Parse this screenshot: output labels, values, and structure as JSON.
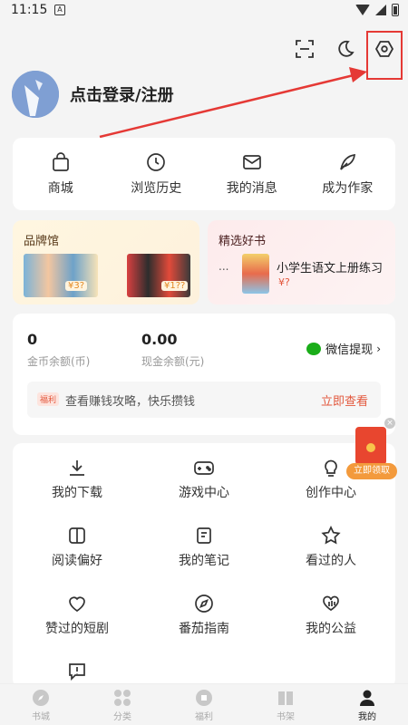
{
  "status": {
    "time": "11:15",
    "notif_icon": "A"
  },
  "header": {
    "login_label": "点击登录/注册"
  },
  "quick_actions": [
    {
      "label": "商城",
      "icon": "bag-icon"
    },
    {
      "label": "浏览历史",
      "icon": "clock-icon"
    },
    {
      "label": "我的消息",
      "icon": "mail-icon"
    },
    {
      "label": "成为作家",
      "icon": "feather-icon"
    }
  ],
  "banners": {
    "left": {
      "title": "品牌馆",
      "price1": "¥3?",
      "price2": "¥1??"
    },
    "right": {
      "title": "精选好书",
      "dots": "...",
      "book_title": "小学生语文上册练习",
      "price": "¥?"
    }
  },
  "wallet": {
    "coins_value": "0",
    "coins_label": "金币余额(币)",
    "cash_value": "0.00",
    "cash_label": "现金余额(元)",
    "withdraw_label": "微信提现",
    "tip_badge": "福利",
    "tip_text": "查看赚钱攻略，快乐攒钱",
    "tip_link": "立即查看"
  },
  "grid_items": [
    {
      "label": "我的下载",
      "icon": "download-icon"
    },
    {
      "label": "游戏中心",
      "icon": "gamepad-icon"
    },
    {
      "label": "创作中心",
      "icon": "bulb-icon"
    },
    {
      "label": "阅读偏好",
      "icon": "book-icon"
    },
    {
      "label": "我的笔记",
      "icon": "note-icon"
    },
    {
      "label": "看过的人",
      "icon": "star-icon"
    },
    {
      "label": "赞过的短剧",
      "icon": "heart-icon"
    },
    {
      "label": "番茄指南",
      "icon": "compass-icon"
    },
    {
      "label": "我的公益",
      "icon": "charity-icon"
    },
    {
      "label": "",
      "icon": "feedback-icon"
    }
  ],
  "red_packet": {
    "label": "立即领取"
  },
  "tabbar": [
    {
      "label": "书城",
      "icon": "compass-tab-icon"
    },
    {
      "label": "分类",
      "icon": "category-icon"
    },
    {
      "label": "福利",
      "icon": "gift-icon"
    },
    {
      "label": "书架",
      "icon": "bookshelf-icon"
    },
    {
      "label": "我的",
      "icon": "person-icon",
      "active": true
    }
  ],
  "colors": {
    "accent": "#e3583d",
    "highlight": "#e53935",
    "wechat": "#1aad19"
  }
}
